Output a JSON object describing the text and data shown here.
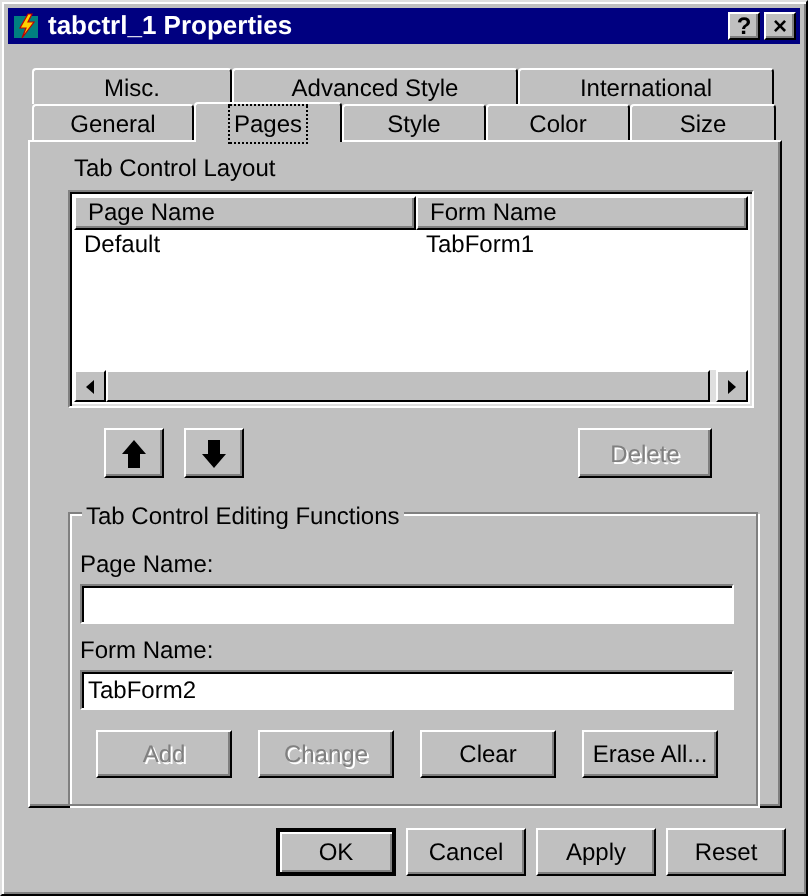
{
  "window": {
    "title": "tabctrl_1 Properties",
    "controls": [
      "?",
      "×"
    ]
  },
  "tabs": [
    [
      {
        "label": "Misc.",
        "selected": false
      },
      {
        "label": "Advanced Style",
        "selected": false
      },
      {
        "label": "International",
        "selected": false
      }
    ],
    [
      {
        "label": "General",
        "selected": false
      },
      {
        "label": "Pages",
        "selected": true
      },
      {
        "label": "Style",
        "selected": false
      },
      {
        "label": "Color",
        "selected": false
      },
      {
        "label": "Size",
        "selected": false
      }
    ]
  ],
  "layout": {
    "label": "Tab Control Layout",
    "columns": [
      "Page Name",
      "Form Name"
    ],
    "rows": [
      [
        "Default",
        "TabForm1"
      ]
    ],
    "delete": {
      "label": "Delete",
      "disabled": true
    }
  },
  "editing": {
    "title": "Tab Control Editing Functions",
    "fields": [
      {
        "label": "Page Name:"
      },
      {
        "label": "Form Name:",
        "value": "TabForm2"
      }
    ],
    "buttons": [
      {
        "label": "Add",
        "disabled": true
      },
      {
        "label": "Change",
        "disabled": true
      },
      {
        "label": "Clear",
        "disabled": false
      },
      {
        "label": "Erase All...",
        "disabled": false
      }
    ]
  },
  "buttons": [
    {
      "label": "OK",
      "default": true
    },
    {
      "label": "Cancel",
      "default": false
    },
    {
      "label": "Apply",
      "default": false
    },
    {
      "label": "Reset",
      "default": false
    }
  ]
}
